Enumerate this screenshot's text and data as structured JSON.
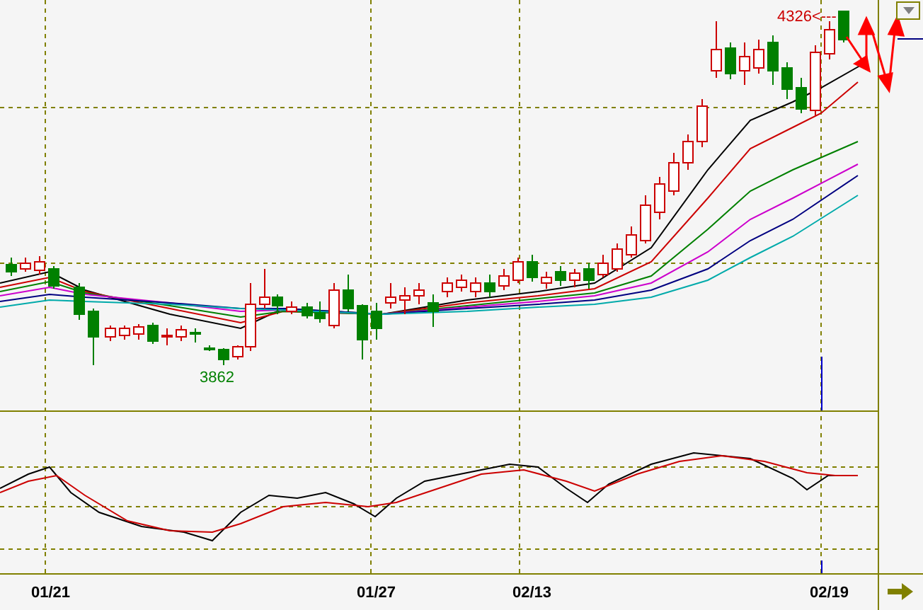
{
  "chart": {
    "high_marker": "4326<---",
    "low_marker": "3862"
  },
  "time_axis": {
    "dates": [
      "01/21",
      "01/27",
      "02/13",
      "02/19"
    ]
  }
}
